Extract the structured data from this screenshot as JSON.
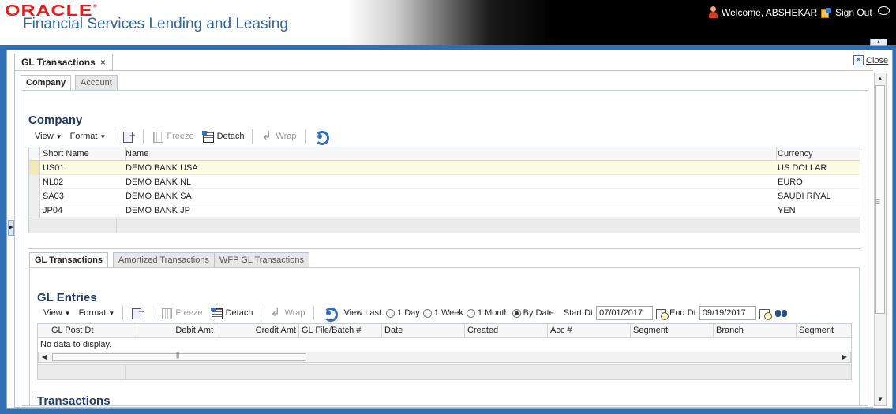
{
  "header": {
    "brand": "ORACLE",
    "product": "Financial Services Lending and Leasing",
    "welcome": "Welcome, ABSHEKAR",
    "signout": "Sign Out"
  },
  "main_tab": {
    "label": "GL Transactions",
    "close_x": "×"
  },
  "close": "Close",
  "top_tabs": {
    "company": "Company",
    "account": "Account"
  },
  "company": {
    "title": "Company",
    "toolbar": {
      "view": "View",
      "format": "Format",
      "freeze": "Freeze",
      "detach": "Detach",
      "wrap": "Wrap"
    },
    "columns": [
      "Short Name",
      "Name",
      "Currency"
    ],
    "rows": [
      {
        "short": "US01",
        "name": "DEMO BANK USA",
        "currency": "US DOLLAR"
      },
      {
        "short": "NL02",
        "name": "DEMO BANK NL",
        "currency": "EURO"
      },
      {
        "short": "SA03",
        "name": "DEMO BANK SA",
        "currency": "SAUDI RIYAL"
      },
      {
        "short": "JP04",
        "name": "DEMO BANK JP",
        "currency": "YEN"
      }
    ]
  },
  "lower_tabs": {
    "gl": "GL Transactions",
    "amortized": "Amortized Transactions",
    "wfp": "WFP GL Transactions"
  },
  "gl_entries": {
    "title": "GL Entries",
    "toolbar": {
      "view": "View",
      "format": "Format",
      "freeze": "Freeze",
      "detach": "Detach",
      "wrap": "Wrap",
      "view_last": "View Last",
      "radio_1day": "1 Day",
      "radio_1week": "1 Week",
      "radio_1month": "1 Month",
      "radio_bydate": "By Date",
      "selected_radio": "By Date",
      "start_label": "Start Dt",
      "start_value": "07/01/2017",
      "end_label": "End Dt",
      "end_value": "09/19/2017"
    },
    "columns": [
      "GL Post Dt",
      "Debit Amt",
      "Credit Amt",
      "GL File/Batch #",
      "Date",
      "Created",
      "Acc #",
      "Segment",
      "Branch",
      "Segment"
    ],
    "empty_text": "No data to display."
  },
  "transactions": {
    "title": "Transactions"
  },
  "colors": {
    "frame_blue": "#2f6fb3",
    "title_navy": "#1f3a66",
    "brand_red": "#e0201b",
    "product_blue": "#336699"
  }
}
